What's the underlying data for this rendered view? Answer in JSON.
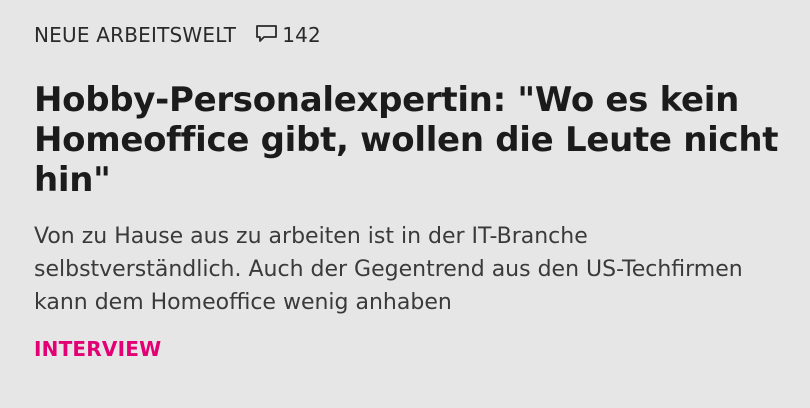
{
  "article": {
    "kicker": "NEUE ARBEITSWELT",
    "comments": {
      "icon": "comment-icon",
      "count": "142"
    },
    "headline": "Hobby-Personalexpertin: \"Wo es kein Homeoffice gibt, wollen die Leute nicht hin\"",
    "teaser": "Von zu Hause aus zu arbeiten ist in der IT-Branche selbstverständlich. Auch der Gegentrend aus den US-Techfirmen kann dem Homeoffice wenig anhaben",
    "tag": "INTERVIEW"
  },
  "colors": {
    "background": "#e6e6e6",
    "text": "#1b1b1b",
    "accent": "#e20074"
  }
}
